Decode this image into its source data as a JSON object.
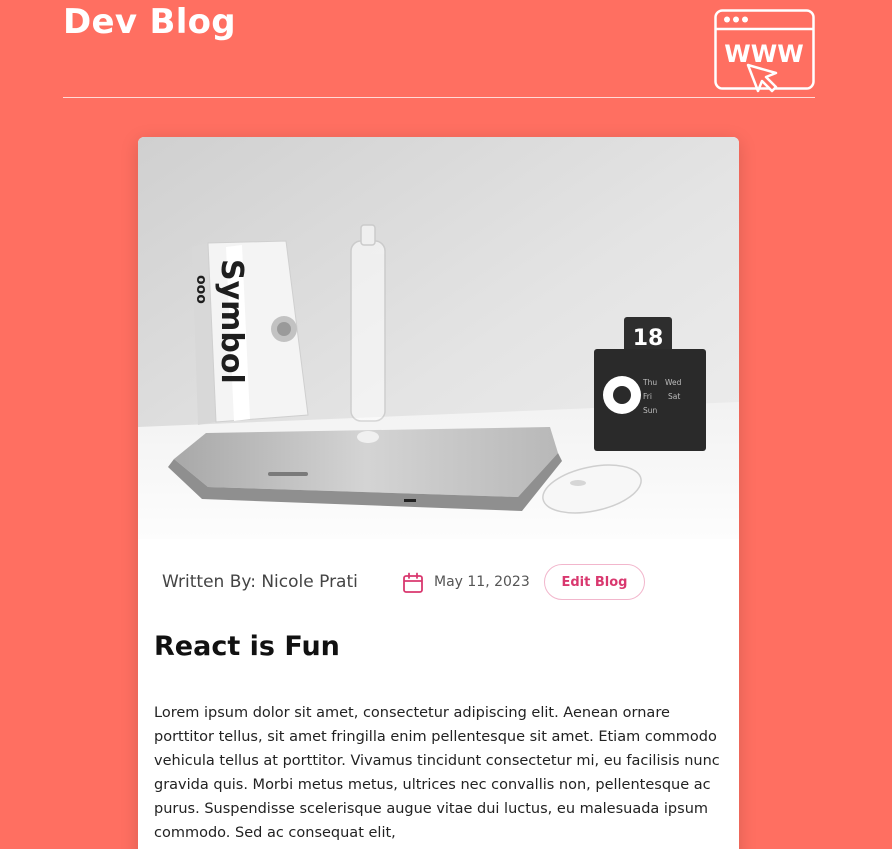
{
  "header": {
    "site_title": "Dev Blog",
    "icon": "website-www-cursor-icon",
    "icon_text": "WWW"
  },
  "post": {
    "image": "laptop-desk-photo",
    "author_label": "Written By: Nicole Prati",
    "date_icon": "calendar-icon",
    "date": "May 11, 2023",
    "edit_label": "Edit Blog",
    "title": "React is Fun",
    "body": "Lorem ipsum dolor sit amet, consectetur adipiscing elit. Aenean ornare porttitor tellus, sit amet fringilla enim pellentesque sit amet. Etiam commodo vehicula tellus at porttitor. Vivamus tincidunt consectetur mi, eu facilisis nunc gravida quis. Morbi metus metus, ultrices nec convallis non, pellentesque ac purus. Suspendisse scelerisque augue vitae dui luctus, eu malesuada ipsum commodo. Sed ac consequat elit,"
  },
  "photo_text": {
    "book_spine": "Symbol",
    "book_logo": "ooo",
    "calendar_number": "18",
    "day_thu": "Thu",
    "day_wed": "Wed",
    "day_fri": "Fri",
    "day_sat": "Sat",
    "day_sun": "Sun"
  },
  "colors": {
    "background": "#ff6f61",
    "accent": "#d9386f",
    "card": "#ffffff"
  }
}
